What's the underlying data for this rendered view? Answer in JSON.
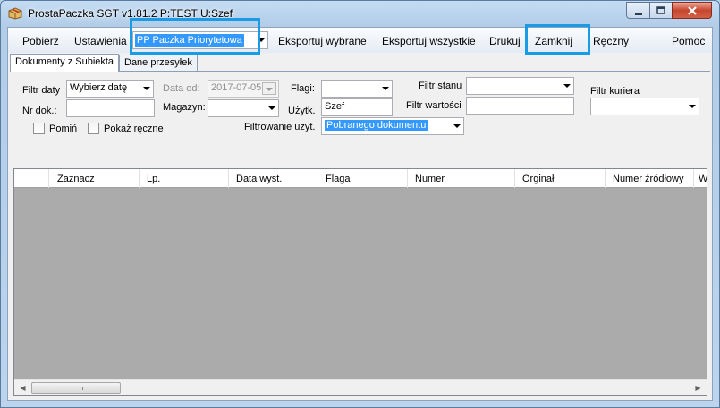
{
  "window": {
    "title": "ProstaPaczka SGT v1.81.2 P:TEST U:Szef"
  },
  "menu": {
    "pobierz": "Pobierz",
    "ustawienia": "Ustawienia",
    "carrier_selected": "PP Paczka Priorytetowa",
    "eksportuj_wybrane": "Eksportuj wybrane",
    "eksportuj_wszystkie": "Eksportuj wszystkie",
    "drukuj": "Drukuj",
    "zamknij": "Zamknij",
    "reczny": "Ręczny",
    "pomoc": "Pomoc"
  },
  "tabs": [
    {
      "label": "Dokumenty z Subiekta"
    },
    {
      "label": "Dane przesyłek"
    }
  ],
  "filters": {
    "filtr_daty_label": "Filtr daty",
    "filtr_daty_value": "Wybierz datę",
    "data_od_label": "Data od:",
    "data_od_value": "2017-07-05",
    "flagi_label": "Flagi:",
    "flagi_value": "",
    "filtr_stanu_label": "Filtr stanu",
    "filtr_stanu_value": "",
    "filtr_kuriera_label": "Filtr kuriera",
    "filtr_kuriera_value": "",
    "nr_dok_label": "Nr dok.:",
    "nr_dok_value": "",
    "magazyn_label": "Magazyn:",
    "magazyn_value": "",
    "uzytk_label": "Użytk.",
    "uzytk_value": "Szef",
    "filtr_wartosci_label": "Filtr wartości",
    "filtr_wartosci_value": "",
    "pomin_label": "Pomiń",
    "pomin_checked": false,
    "pokaz_reczne_label": "Pokaż ręczne",
    "pokaz_reczne_checked": false,
    "filtrowanie_label": "Filtrowanie użyt.",
    "filtrowanie_value": "Pobranego dokumentu"
  },
  "grid": {
    "columns": [
      "Zaznacz",
      "Lp.",
      "Data wyst.",
      "Flaga",
      "Numer",
      "Orginał",
      "Numer źródłowy",
      "W"
    ],
    "rows": []
  },
  "colors": {
    "highlight": "#1a9be6",
    "selection": "#3399ff",
    "grid_empty": "#ababab"
  }
}
